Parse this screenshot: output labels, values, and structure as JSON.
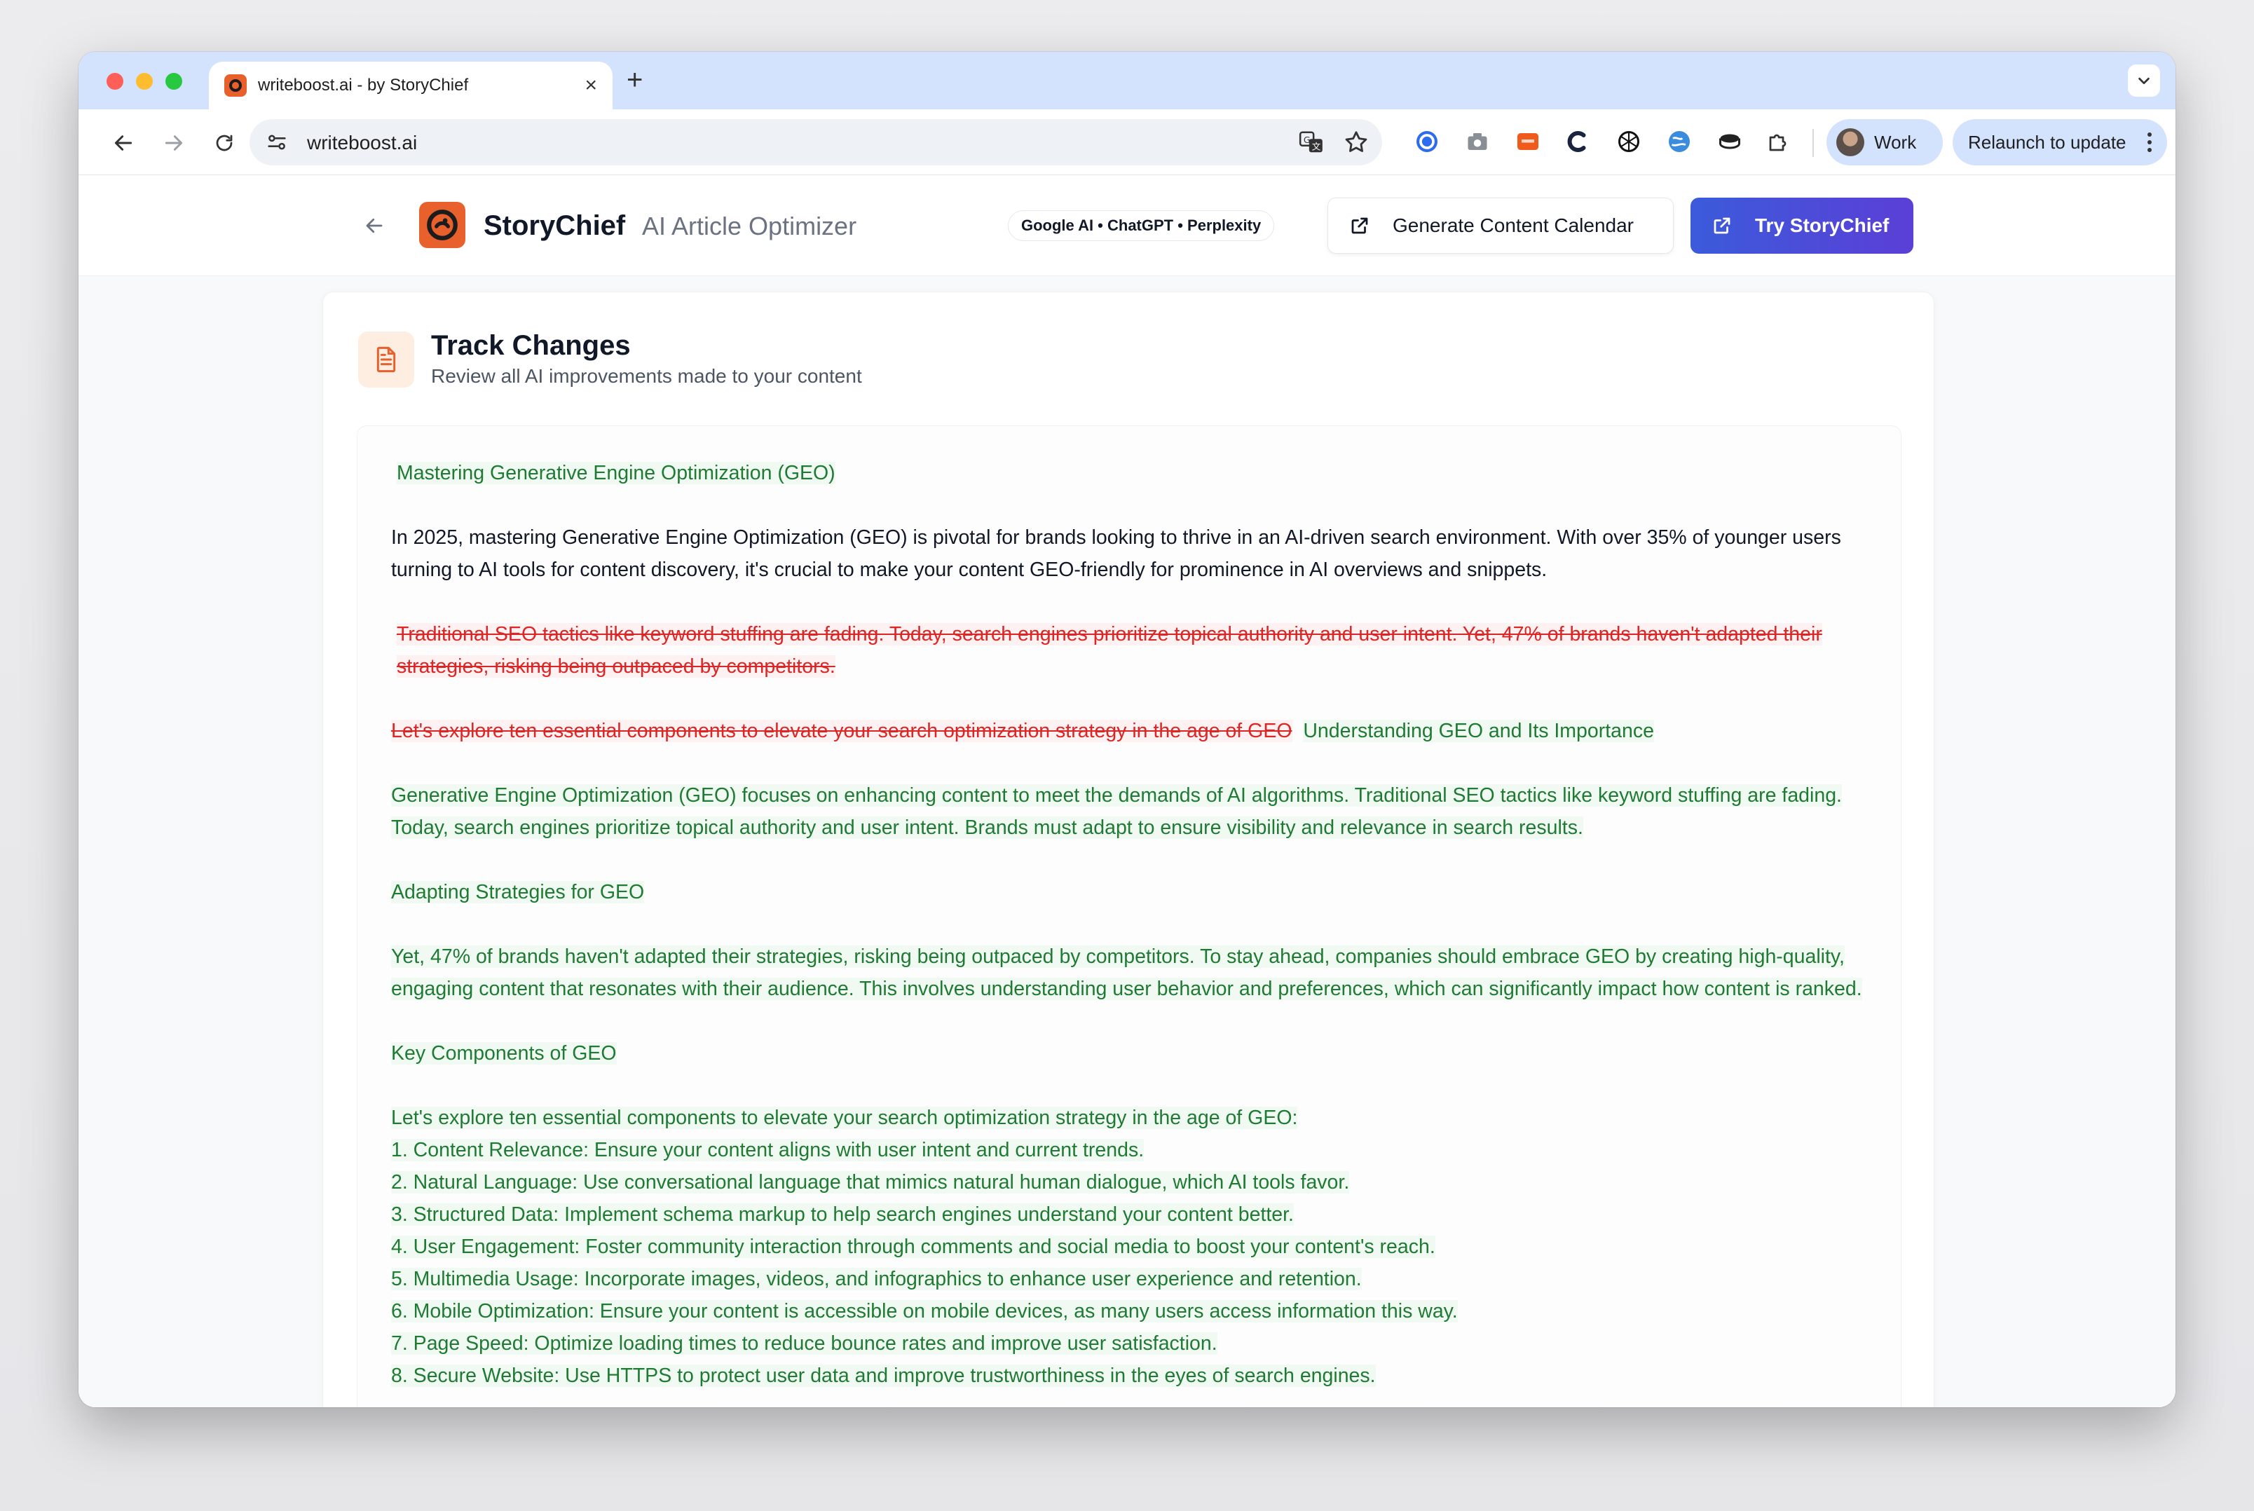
{
  "browser": {
    "tab_title": "writeboost.ai - by StoryChief",
    "tab_close": "×",
    "new_tab": "+",
    "url": "writeboost.ai",
    "profile_label": "Work",
    "relaunch_label": "Relaunch to update",
    "extensions": [
      "translate-icon",
      "bookmark-star-icon",
      "colorful-circle-icon",
      "camera-icon",
      "orange-badge-icon",
      "c-letter-icon",
      "openai-icon",
      "globe-icon",
      "coin-stack-icon",
      "puzzle-icon"
    ]
  },
  "header": {
    "brand_name": "StoryChief",
    "brand_sub": "AI Article Optimizer",
    "engines_pill": "Google AI • ChatGPT • Perplexity",
    "calendar_button": "Generate Content Calendar",
    "try_button": "Try StoryChief",
    "brand_color": "#e8612c",
    "cta_color": "#3b5bdb"
  },
  "card": {
    "title": "Track Changes",
    "subtitle": "Review all AI improvements made to your content"
  },
  "doc": {
    "heading_ins": "Mastering Generative Engine Optimization (GEO)",
    "intro": "In 2025, mastering Generative Engine Optimization (GEO) is pivotal for brands looking to thrive in an AI-driven search environment. With over 35% of younger users turning to AI tools for content discovery, it's crucial to make your content GEO-friendly for prominence in AI overviews and snippets.",
    "del_para": "Traditional SEO tactics like keyword stuffing are fading. Today, search engines prioritize topical authority and user intent. Yet, 47% of brands haven't adapted their strategies, risking being outpaced by competitors.",
    "del_line": "Let's explore ten essential components to elevate your search optimization strategy in the age of GEO",
    "ins_heading_2": "Understanding GEO and Its Importance",
    "ins_para_1": "Generative Engine Optimization (GEO) focuses on enhancing content to meet the demands of AI algorithms. Traditional SEO tactics like keyword stuffing are fading. Today, search engines prioritize topical authority and user intent. Brands must adapt to ensure visibility and relevance in search results.",
    "ins_heading_3": "Adapting Strategies for GEO",
    "ins_para_2": "Yet, 47% of brands haven't adapted their strategies, risking being outpaced by competitors. To stay ahead, companies should embrace GEO by creating high-quality, engaging content that resonates with their audience. This involves understanding user behavior and preferences, which can significantly impact how content is ranked.",
    "ins_heading_4": "Key Components of GEO",
    "list_intro": "Let's explore ten essential components to elevate your search optimization strategy in the age of GEO:",
    "list": [
      "1. Content Relevance: Ensure your content aligns with user intent and current trends.",
      "2. Natural Language: Use conversational language that mimics natural human dialogue, which AI tools favor.",
      "3. Structured Data: Implement schema markup to help search engines understand your content better.",
      "4. User Engagement: Foster community interaction through comments and social media to boost your content's reach.",
      "5. Multimedia Usage: Incorporate images, videos, and infographics to enhance user experience and retention.",
      "6. Mobile Optimization: Ensure your content is accessible on mobile devices, as many users access information this way.",
      "7. Page Speed: Optimize loading times to reduce bounce rates and improve user satisfaction.",
      "8. Secure Website: Use HTTPS to protect user data and improve trustworthiness in the eyes of search engines."
    ],
    "insert_color": "#1f7a33",
    "delete_color": "#dc2626"
  }
}
